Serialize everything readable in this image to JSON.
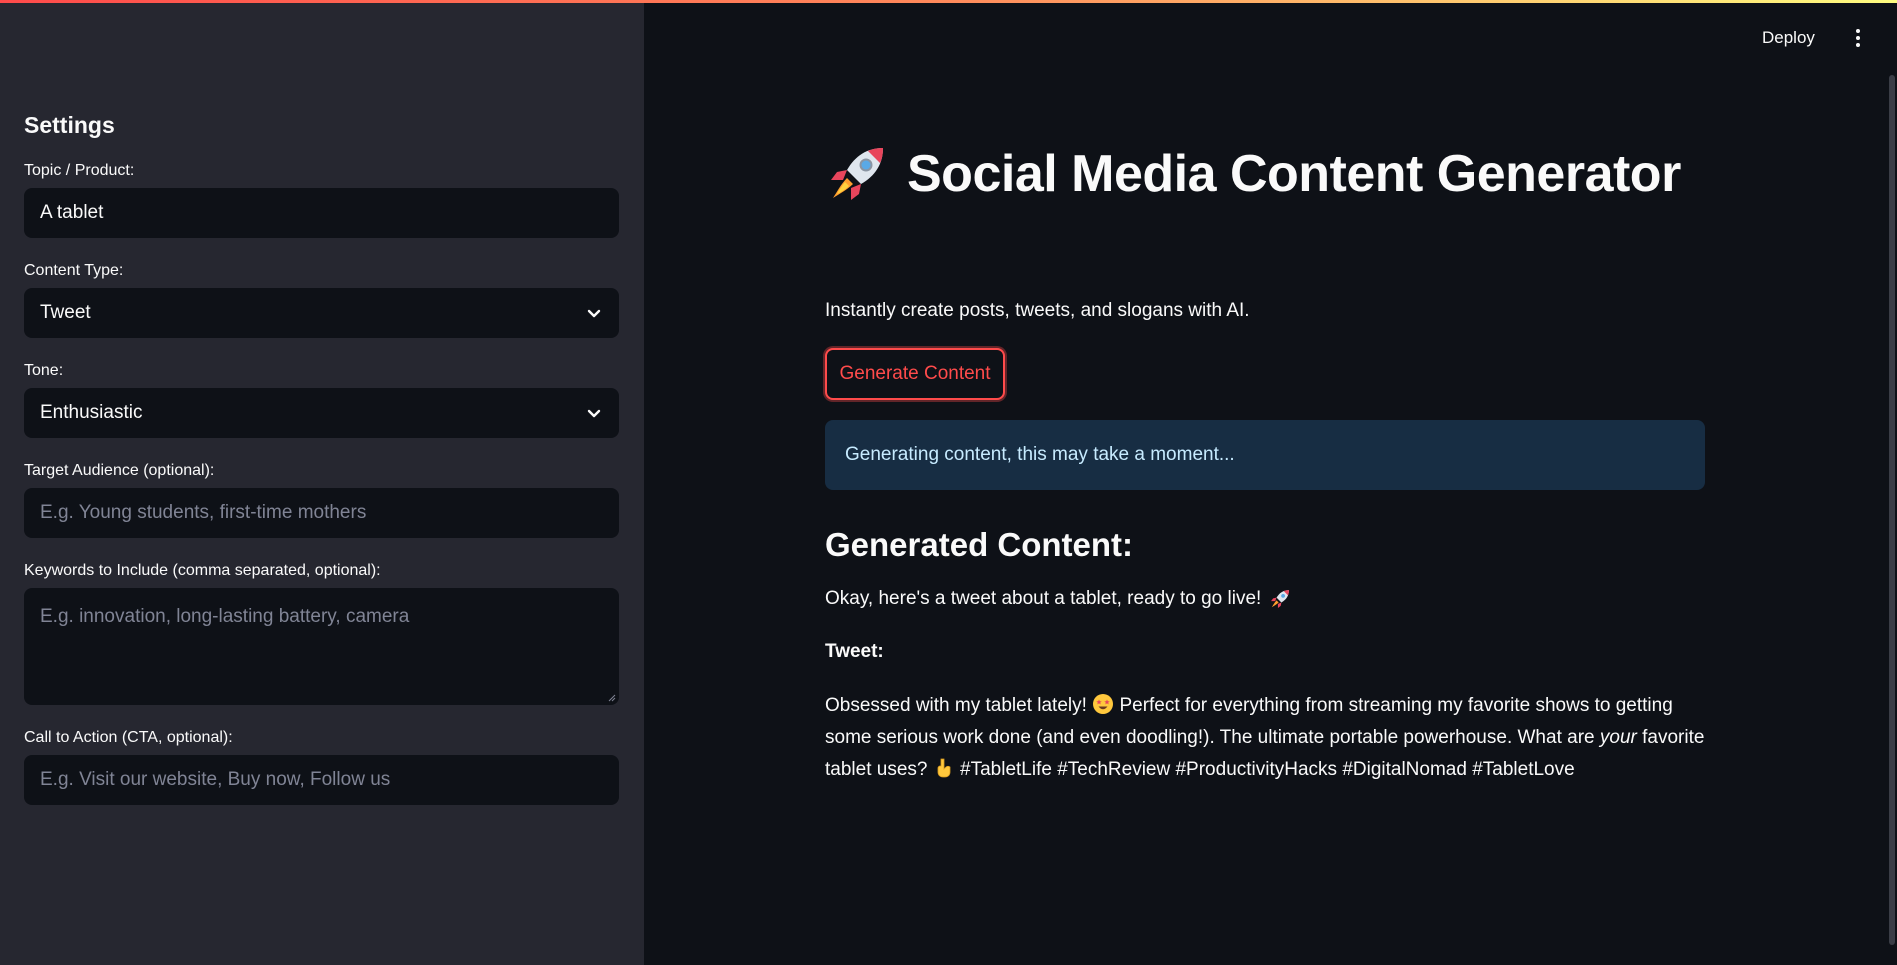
{
  "header": {
    "deploy_label": "Deploy"
  },
  "sidebar": {
    "heading": "Settings",
    "topic": {
      "label": "Topic / Product:",
      "value": "A tablet"
    },
    "content_type": {
      "label": "Content Type:",
      "value": "Tweet"
    },
    "tone": {
      "label": "Tone:",
      "value": "Enthusiastic"
    },
    "audience": {
      "label": "Target Audience (optional):",
      "placeholder": "E.g. Young students, first-time mothers"
    },
    "keywords": {
      "label": "Keywords to Include (comma separated, optional):",
      "placeholder": "E.g. innovation, long-lasting battery, camera"
    },
    "cta": {
      "label": "Call to Action (CTA, optional):",
      "placeholder": "E.g. Visit our website, Buy now, Follow us"
    }
  },
  "main": {
    "title": "Social Media Content Generator",
    "subtitle": "Instantly create posts, tweets, and slogans with AI.",
    "generate_button": "Generate Content",
    "info_message": "Generating content, this may take a moment...",
    "generated_heading": "Generated Content:",
    "intro_line": "Okay, here's a tweet about a tablet, ready to go live!",
    "tweet_label": "Tweet:",
    "tweet_part1": "Obsessed with my tablet lately!",
    "tweet_part2": "Perfect for everything from streaming my favorite shows to getting some serious work done (and even doodling!). The ultimate portable powerhouse. What are",
    "tweet_emphasis": "your",
    "tweet_part3": "favorite tablet uses?",
    "tweet_hashtags": "#TabletLife #TechReview #ProductivityHacks #DigitalNomad #TabletLove"
  },
  "colors": {
    "accent": "#ff4b4b",
    "sidebar_bg": "#262730",
    "main_bg": "#0e1117",
    "info_bg": "#172d43",
    "info_text": "#c7ebff"
  },
  "icons": [
    "rocket-icon",
    "star-struck-emoji-icon",
    "pointing-down-emoji-icon",
    "chevron-down-icon",
    "kebab-menu-icon"
  ]
}
